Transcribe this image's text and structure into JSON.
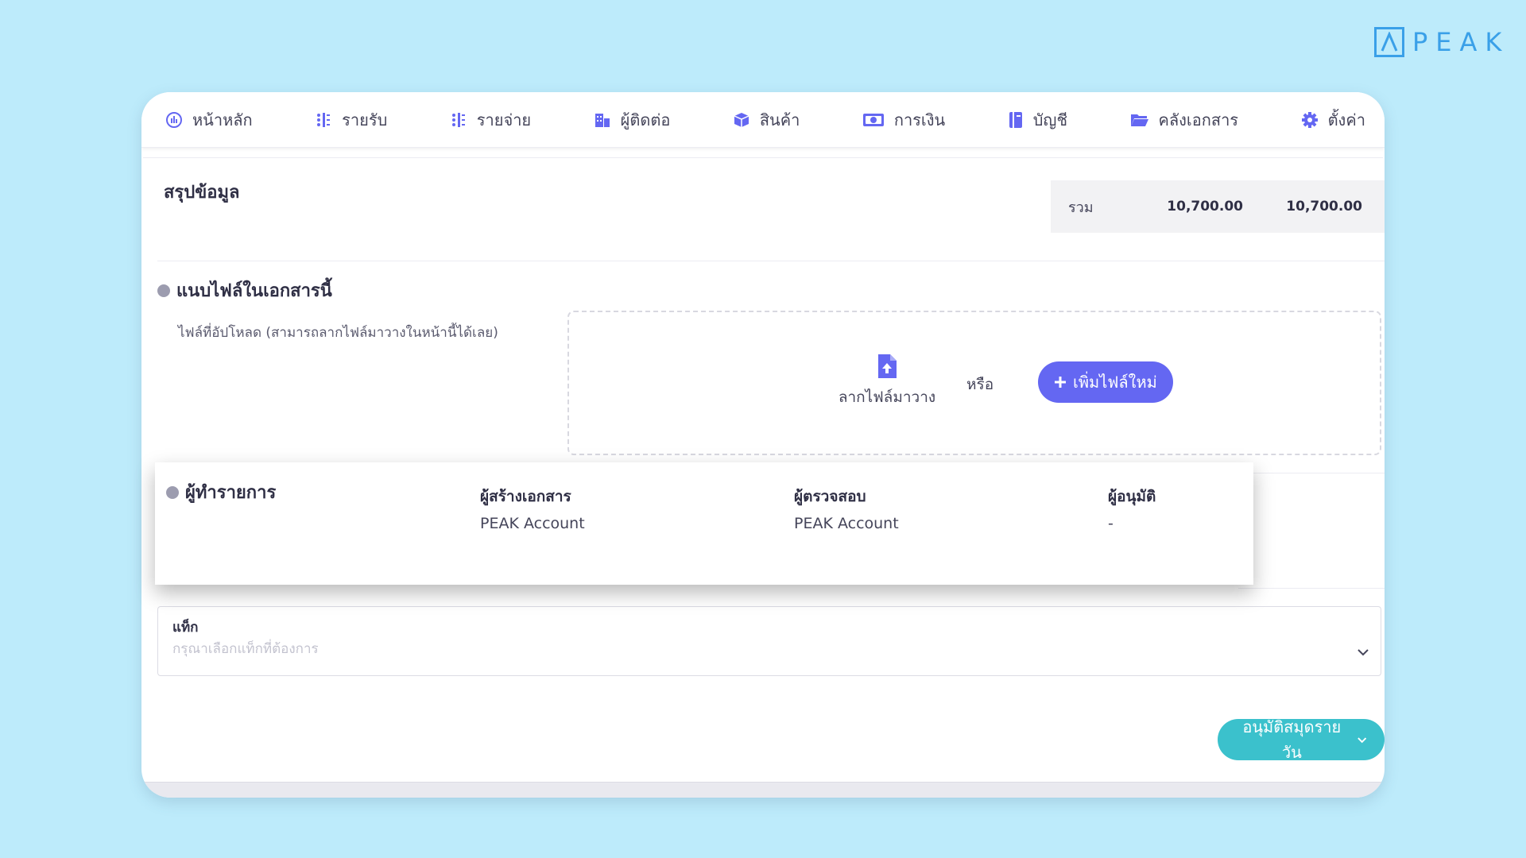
{
  "brand": {
    "name": "PEAK",
    "color": "#3aa0e8"
  },
  "nav": {
    "items": [
      {
        "label": "หน้าหลัก",
        "icon": "dashboard-icon"
      },
      {
        "label": "รายรับ",
        "icon": "income-list-icon"
      },
      {
        "label": "รายจ่าย",
        "icon": "expense-list-icon"
      },
      {
        "label": "ผู้ติดต่อ",
        "icon": "contacts-icon"
      },
      {
        "label": "สินค้า",
        "icon": "product-box-icon"
      },
      {
        "label": "การเงิน",
        "icon": "money-icon"
      },
      {
        "label": "บัญชี",
        "icon": "accounting-book-icon"
      },
      {
        "label": "คลังเอกสาร",
        "icon": "folder-icon"
      },
      {
        "label": "ตั้งค่า",
        "icon": "gear-icon"
      }
    ]
  },
  "summary": {
    "title": "สรุปข้อมูล",
    "total_label": "รวม",
    "value_1": "10,700.00",
    "value_2": "10,700.00"
  },
  "attachments": {
    "title": "แนบไฟล์ในเอกสารนี้",
    "upload_hint": "ไฟล์ที่อัปโหลด (สามารถลากไฟล์มาวางในหน้านี้ได้เลย)",
    "drop_label": "ลากไฟล์มาวาง",
    "or_label": "หรือ",
    "add_file_label": "เพิ่มไฟล์ใหม่",
    "accent_color": "#6467f2"
  },
  "actors": {
    "title": "ผู้ทำรายการ",
    "creator_label": "ผู้สร้างเอกสาร",
    "creator_value": "PEAK Account",
    "reviewer_label": "ผู้ตรวจสอบ",
    "reviewer_value": "PEAK Account",
    "approver_label": "ผู้อนุมัติ",
    "approver_value": "-"
  },
  "tag": {
    "label": "แท็ก",
    "placeholder": "กรุณาเลือกแท็กที่ต้องการ"
  },
  "approve": {
    "label": "อนุมัติสมุดรายวัน",
    "color": "#3bc1cc"
  }
}
